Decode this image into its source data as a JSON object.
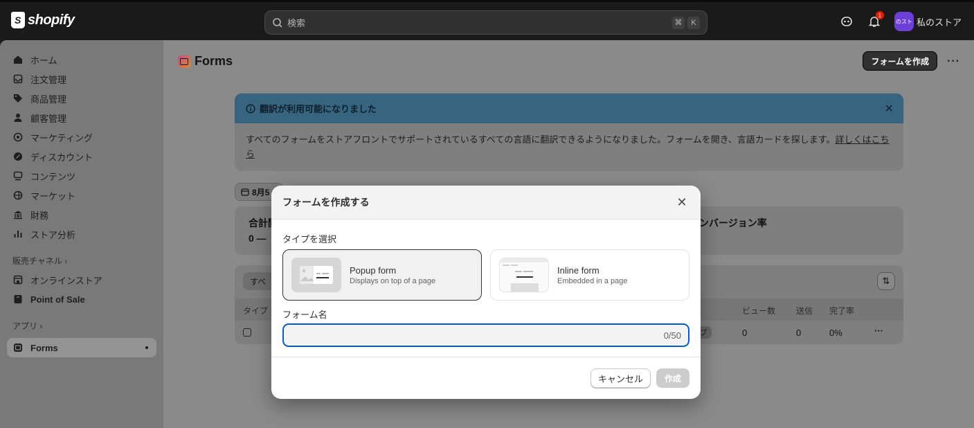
{
  "topbar": {
    "logo_text": "shopify",
    "search_placeholder": "検索",
    "shortcut_key1": "⌘",
    "shortcut_key2": "K",
    "notification_count": "1",
    "store_avatar": "のスト",
    "store_name": "私のストア"
  },
  "sidebar": {
    "items": [
      {
        "label": "ホーム",
        "icon": "home-icon"
      },
      {
        "label": "注文管理",
        "icon": "inbox-icon"
      },
      {
        "label": "商品管理",
        "icon": "tag-icon"
      },
      {
        "label": "顧客管理",
        "icon": "person-icon"
      },
      {
        "label": "マーケティング",
        "icon": "target-icon"
      },
      {
        "label": "ディスカウント",
        "icon": "discount-icon"
      },
      {
        "label": "コンテンツ",
        "icon": "content-icon"
      },
      {
        "label": "マーケット",
        "icon": "globe-icon"
      },
      {
        "label": "財務",
        "icon": "bank-icon"
      },
      {
        "label": "ストア分析",
        "icon": "chart-icon"
      }
    ],
    "sales_channels_label": "販売チャネル ›",
    "channels": [
      {
        "label": "オンラインストア",
        "icon": "store-icon"
      },
      {
        "label": "Point of Sale",
        "icon": "pos-icon"
      }
    ],
    "apps_label": "アプリ ›",
    "active_app": "Forms"
  },
  "page": {
    "title": "Forms",
    "create_button": "フォームを作成",
    "more": "···"
  },
  "banner": {
    "title": "翻訳が利用可能になりました",
    "body": "すべてのフォームをストアフロントでサポートされているすべての言語に翻訳できるようになりました。フォームを開き、言語カードを探します。",
    "link": "詳しくはこちら"
  },
  "filters": {
    "date": "8月5"
  },
  "stats": {
    "label1": "合計閲",
    "value1": "0 —",
    "label2": "ンバージョン率"
  },
  "table": {
    "tab": "すべ",
    "headers": {
      "type": "タイプ",
      "views": "ビュー数",
      "sends": "送信",
      "completion": "完了率"
    },
    "row": {
      "chip": "ブ",
      "views": "0",
      "sends": "0",
      "completion": "0%",
      "more": "···"
    }
  },
  "modal": {
    "title": "フォームを作成する",
    "type_label": "タイプを選択",
    "types": [
      {
        "title": "Popup form",
        "subtitle": "Displays on top of a page",
        "selected": true
      },
      {
        "title": "Inline form",
        "subtitle": "Embedded in a page",
        "selected": false
      }
    ],
    "name_label": "フォーム名",
    "name_value": "",
    "counter": "0/50",
    "cancel": "キャンセル",
    "create": "作成"
  },
  "colors": {
    "accent": "#005bd3",
    "banner": "#37657f",
    "primary_button": "#303030"
  }
}
